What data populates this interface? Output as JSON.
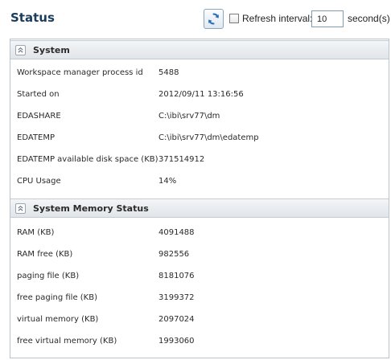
{
  "header": {
    "title": "Status",
    "refresh_label": "Refresh interval:",
    "interval_value": "10",
    "seconds_label": "second(s)",
    "refresh_checked": false
  },
  "system": {
    "title": "System",
    "rows": [
      {
        "label": "Workspace manager process id",
        "value": "5488"
      },
      {
        "label": "Started on",
        "value": "2012/09/11 13:16:56"
      },
      {
        "label": "EDASHARE",
        "value": "C:\\ibi\\srv77\\dm"
      },
      {
        "label": "EDATEMP",
        "value": "C:\\ibi\\srv77\\dm\\edatemp"
      },
      {
        "label": "EDATEMP available disk space (KB)",
        "value": "371514912"
      },
      {
        "label": "CPU Usage",
        "value": "14%"
      }
    ]
  },
  "memory": {
    "title": "System Memory Status",
    "rows": [
      {
        "label": "RAM (KB)",
        "value": "4091488"
      },
      {
        "label": "RAM free (KB)",
        "value": "982556"
      },
      {
        "label": "paging file (KB)",
        "value": "8181076"
      },
      {
        "label": "free paging file (KB)",
        "value": "3199372"
      },
      {
        "label": "virtual memory (KB)",
        "value": "2097024"
      },
      {
        "label": "free virtual memory (KB)",
        "value": "1993060"
      }
    ]
  },
  "icons": {
    "refresh": "refresh-icon",
    "collapse": "collapse-up-icon"
  },
  "colors": {
    "title": "#1b3d5c",
    "accent": "#f0b44a",
    "refresh_icon": "#2e6db4"
  }
}
